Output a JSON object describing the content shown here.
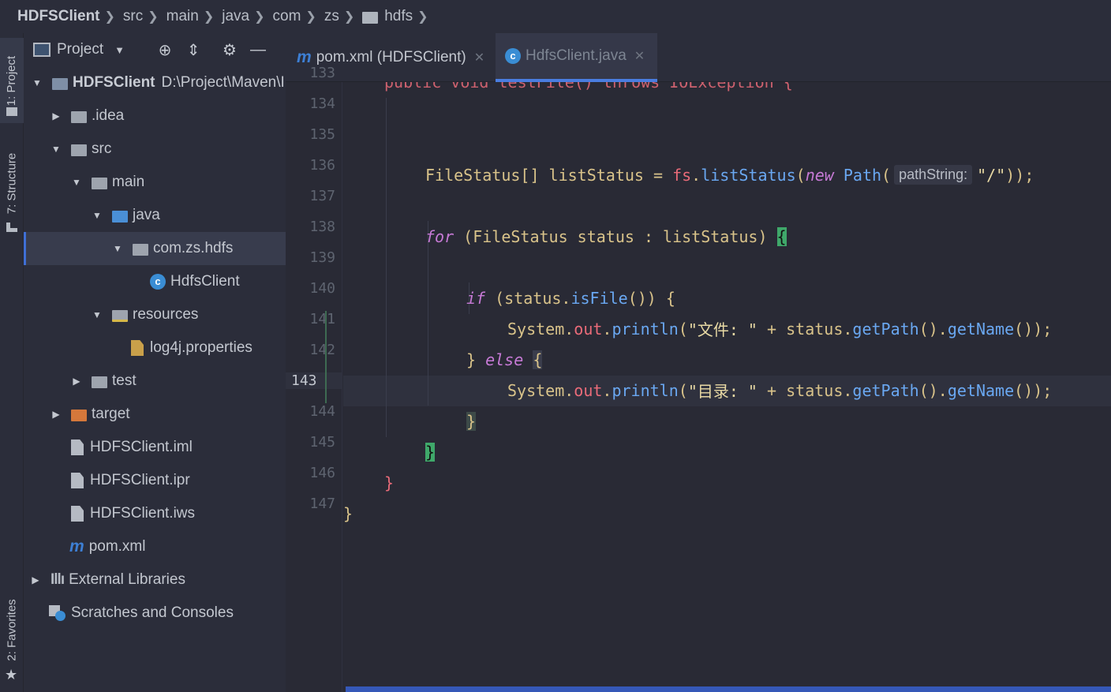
{
  "breadcrumb": {
    "items": [
      "HDFSClient",
      "src",
      "main",
      "java",
      "com",
      "zs",
      "hdfs"
    ]
  },
  "side_tabs": {
    "project": "1: Project",
    "structure": "7: Structure",
    "favorites": "2: Favorites"
  },
  "project_panel": {
    "title": "Project",
    "tree": [
      {
        "label": "HDFSClient",
        "extra": "D:\\Project\\Maven\\I",
        "depth": 0,
        "arrow": "▼",
        "icon": "module-folder-icon"
      },
      {
        "label": ".idea",
        "depth": 1,
        "arrow": "▶",
        "icon": "folder-icon"
      },
      {
        "label": "src",
        "depth": 1,
        "arrow": "▼",
        "icon": "folder-icon"
      },
      {
        "label": "main",
        "depth": 2,
        "arrow": "▼",
        "icon": "folder-icon"
      },
      {
        "label": "java",
        "depth": 3,
        "arrow": "▼",
        "icon": "source-folder-icon"
      },
      {
        "label": "com.zs.hdfs",
        "depth": 4,
        "arrow": "▼",
        "icon": "package-icon",
        "selected": true
      },
      {
        "label": "HdfsClient",
        "depth": 5,
        "arrow": "",
        "icon": "java-class-icon"
      },
      {
        "label": "resources",
        "depth": 3,
        "arrow": "▼",
        "icon": "resources-folder-icon"
      },
      {
        "label": "log4j.properties",
        "depth": 4,
        "arrow": "",
        "icon": "properties-file-icon"
      },
      {
        "label": "test",
        "depth": 2,
        "arrow": "▶",
        "icon": "folder-icon"
      },
      {
        "label": "target",
        "depth": 1,
        "arrow": "▶",
        "icon": "excluded-folder-icon"
      },
      {
        "label": "HDFSClient.iml",
        "depth": 1,
        "arrow": "",
        "icon": "file-icon"
      },
      {
        "label": "HDFSClient.ipr",
        "depth": 1,
        "arrow": "",
        "icon": "file-icon"
      },
      {
        "label": "HDFSClient.iws",
        "depth": 1,
        "arrow": "",
        "icon": "file-icon"
      },
      {
        "label": "pom.xml",
        "depth": 1,
        "arrow": "",
        "icon": "maven-icon"
      },
      {
        "label": "External Libraries",
        "depth": 0,
        "arrow": "▶",
        "icon": "libraries-icon"
      },
      {
        "label": "Scratches and Consoles",
        "depth": 0,
        "arrow": "",
        "icon": "scratches-icon"
      }
    ]
  },
  "editor_tabs": [
    {
      "label": "pom.xml (HDFSClient)",
      "icon": "maven-icon",
      "active": false
    },
    {
      "label": "HdfsClient.java",
      "icon": "java-class-icon",
      "active": true
    }
  ],
  "line_numbers": [
    "133",
    "134",
    "135",
    "136",
    "137",
    "138",
    "139",
    "140",
    "141",
    "142",
    "143",
    "144",
    "145",
    "146",
    "147"
  ],
  "current_line": "143",
  "code": {
    "l133": "public void testFile() throws IOException {",
    "l135": {
      "t1": "FileStatus[] listStatus = ",
      "t2": "fs",
      "t3": ".",
      "t4": "listStatus",
      "t5": "(",
      "t6": "new",
      "t7": " ",
      "t8": "Path",
      "t9": "(",
      "hint": "pathString:",
      "t10": "\"/\"",
      "t11": "));"
    },
    "l137": {
      "t1": "for",
      "t2": " (FileStatus status : listStatus) ",
      "t3": "{"
    },
    "l139": {
      "t1": "if",
      "t2": " (status.",
      "t3": "isFile",
      "t4": "()) {"
    },
    "l140": {
      "t1": "System.",
      "t2": "out",
      "t3": ".",
      "t4": "println",
      "t5": "(",
      "t6": "\"文件: \"",
      "t7": " + status.",
      "t8": "getPath",
      "t9": "().",
      "t10": "getName",
      "t11": "());"
    },
    "l141": {
      "t1": "} ",
      "t2": "else",
      "t3": " ",
      "t4": "{"
    },
    "l142": {
      "t1": "System.",
      "t2": "out",
      "t3": ".",
      "t4": "println",
      "t5": "(",
      "t6": "\"目录: \"",
      "t7": " + status.",
      "t8": "getPath",
      "t9": "().",
      "t10": "getName",
      "t11": "());"
    },
    "l143": "}",
    "l144": "}",
    "l145": "}",
    "l146": "}"
  }
}
